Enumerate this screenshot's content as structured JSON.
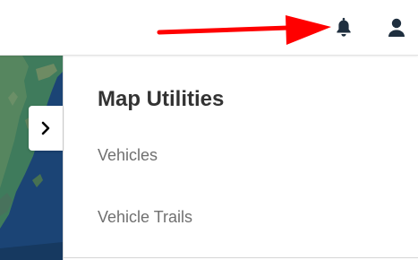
{
  "colors": {
    "annotation_arrow": "#ff0000",
    "icon": "#1f2f3f",
    "title": "#333333",
    "item": "#707070",
    "panel_bg": "#ffffff",
    "map_water": "#1b4475",
    "map_land": "#3f7b5c"
  },
  "header": {
    "notification_icon": "bell-icon",
    "account_icon": "user-icon"
  },
  "map": {
    "toggle_icon": "chevron-right-icon"
  },
  "panel": {
    "title": "Map Utilities",
    "items": [
      {
        "label": "Vehicles"
      },
      {
        "label": "Vehicle Trails"
      }
    ]
  }
}
